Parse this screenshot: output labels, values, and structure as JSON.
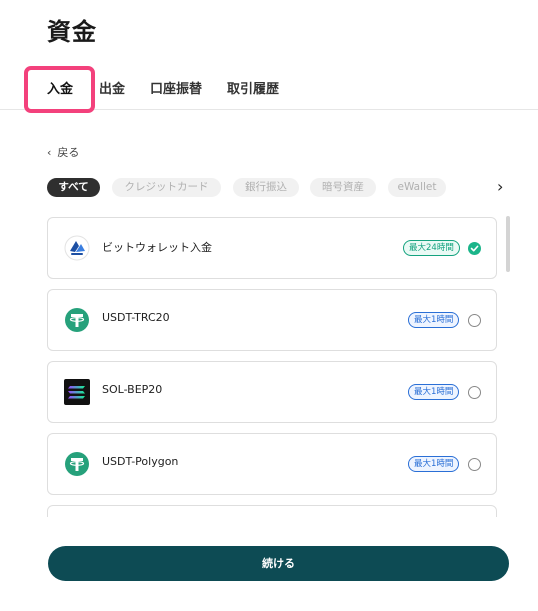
{
  "page": {
    "title": "資金"
  },
  "tabs": [
    {
      "label": "入金",
      "active": true
    },
    {
      "label": "出金"
    },
    {
      "label": "口座振替"
    },
    {
      "label": "取引履歴"
    }
  ],
  "back": {
    "label": "戻る",
    "icon": "chevron-left-icon"
  },
  "filters": {
    "chips": [
      "すべて",
      "クレジットカード",
      "銀行振込",
      "暗号資産",
      "eWallet"
    ],
    "selected": "すべて",
    "next_icon": "chevron-right-icon"
  },
  "methods": [
    {
      "label": "ビットウォレット入金",
      "badge": "最大24時間",
      "badge_color": "#14a37f",
      "selected": true,
      "icon": "bitwallet-icon"
    },
    {
      "label": "USDT-TRC20",
      "badge": "最大1時間",
      "badge_color": "#2a6fd6",
      "selected": false,
      "icon": "tether-icon"
    },
    {
      "label": "SOL-BEP20",
      "badge": "最大1時間",
      "badge_color": "#2a6fd6",
      "selected": false,
      "icon": "solana-icon"
    },
    {
      "label": "USDT-Polygon",
      "badge": "最大1時間",
      "badge_color": "#2a6fd6",
      "selected": false,
      "icon": "tether-icon"
    }
  ],
  "actions": {
    "continue_label": "続ける"
  },
  "colors": {
    "primary": "#0d4b54",
    "highlight": "#f3417c",
    "selected": "#1bb58a",
    "tether": "#26a17b"
  }
}
